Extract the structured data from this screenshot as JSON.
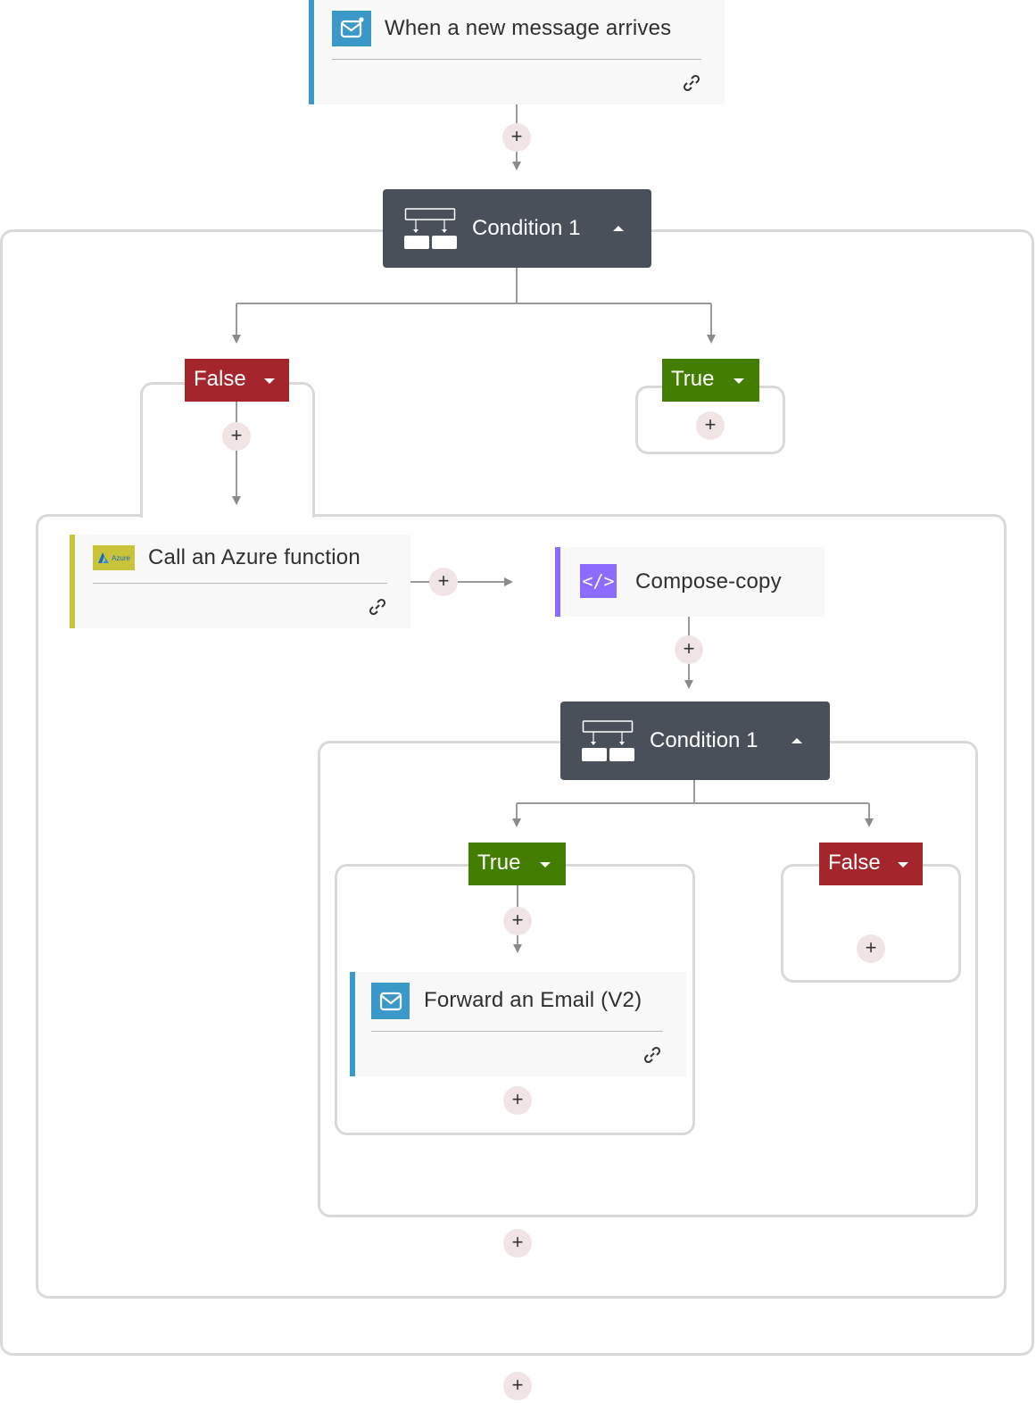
{
  "trigger": {
    "title": "When a new message arrives",
    "icon": "mail-icon",
    "accent": "#3a99c9",
    "link_icon": "link-icon"
  },
  "condition_outer": {
    "title": "Condition 1",
    "icon": "condition-branch-icon",
    "state": "expanded"
  },
  "branches_outer": {
    "false": {
      "label": "False",
      "color": "#a4262c"
    },
    "true": {
      "label": "True",
      "color": "#437e00"
    }
  },
  "azure_action": {
    "title": "Call an Azure function",
    "icon_label": "Azure",
    "accent": "#c9c43a",
    "link_icon": "link-icon"
  },
  "compose_action": {
    "title": "Compose-copy",
    "icon": "code-icon",
    "icon_glyph": "</>",
    "accent": "#8c6cff"
  },
  "condition_inner": {
    "title": "Condition 1",
    "icon": "condition-branch-icon",
    "state": "expanded"
  },
  "branches_inner": {
    "true": {
      "label": "True",
      "color": "#437e00"
    },
    "false": {
      "label": "False",
      "color": "#a4262c"
    }
  },
  "forward_action": {
    "title": "Forward an Email (V2)",
    "icon": "mail-icon",
    "accent": "#3a99c9",
    "link_icon": "link-icon"
  },
  "add_step": {
    "glyph": "+"
  }
}
